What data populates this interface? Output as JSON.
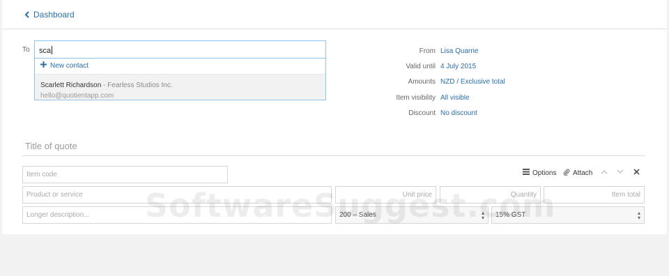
{
  "nav": {
    "back_label": "Dashboard"
  },
  "recipient": {
    "label": "To",
    "input_value": "sca",
    "dropdown": {
      "new_contact_label": "New contact",
      "contact": {
        "name": "Scarlett Richardson",
        "company": " - Fearless Studios Inc.",
        "email": "hello@quotientapp.com"
      }
    }
  },
  "quote_meta": [
    {
      "label": "From",
      "value": "Lisa Quarrie"
    },
    {
      "label": "Valid until",
      "value": "4 July 2015"
    },
    {
      "label": "Amounts",
      "value": "NZD / Exclusive total"
    },
    {
      "label": "Item visibility",
      "value": "All visible"
    },
    {
      "label": "Discount",
      "value": "No discount"
    }
  ],
  "title": {
    "placeholder": "Title of quote"
  },
  "item": {
    "code_placeholder": "Item code",
    "options_label": "Options",
    "attach_label": "Attach",
    "product_placeholder": "Product or service",
    "unit_price_placeholder": "Unit price",
    "quantity_placeholder": "Quantity",
    "item_total_placeholder": "Item total",
    "description_placeholder": "Longer description...",
    "account_value": "200 – Sales",
    "tax_value": "15% GST"
  },
  "watermark": "SoftwareSuggest.com",
  "colors": {
    "link": "#2a6ea9",
    "focus_border": "#8fc3ea"
  }
}
